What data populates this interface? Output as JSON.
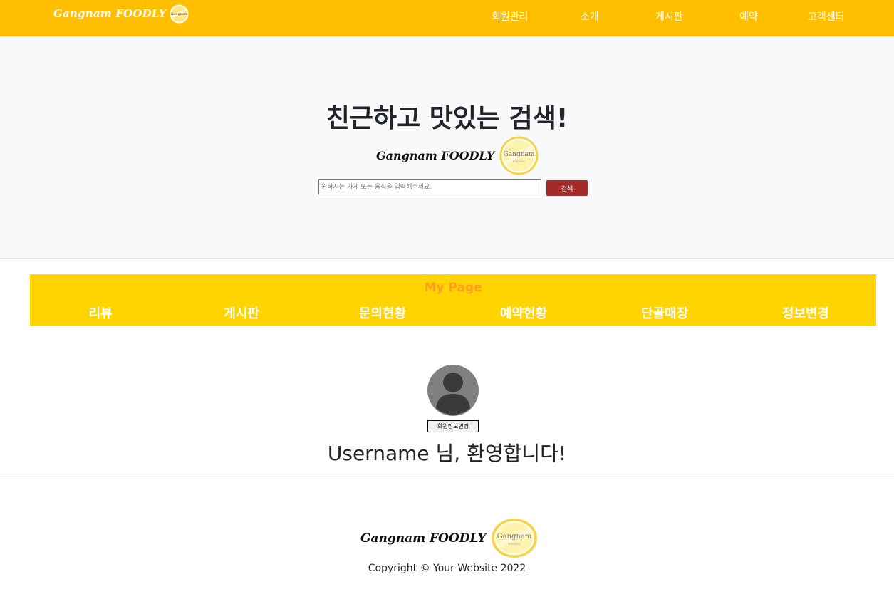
{
  "header": {
    "brand": "Gangnam FOODLY",
    "nav": [
      "회원관리",
      "소개",
      "게시판",
      "예약",
      "고객센터"
    ]
  },
  "hero": {
    "title": "친근하고 맛있는 검색!",
    "logo_text": "Gangnam FOODLY",
    "badge_text": "Gangnam",
    "badge_subtext": "FOODLY",
    "search_placeholder": "원하시는 가게 또는 음식을 입력해주세요.",
    "search_button": "검색"
  },
  "mypage": {
    "title": "My Page",
    "tabs": [
      "리뷰",
      "게시판",
      "문의현황",
      "예약현황",
      "단골매장",
      "정보변경"
    ]
  },
  "profile": {
    "edit_button": "회원정보변경",
    "welcome": "Username 님, 환영합니다!"
  },
  "footer": {
    "logo_text": "Gangnam FOODLY",
    "badge_text": "Gangnam",
    "badge_subtext": "FOODLY",
    "copyright": "Copyright © Your Website 2022"
  },
  "colors": {
    "navbar": "#ffbf00",
    "mypage_bar": "#ffd400",
    "mypage_title": "#ff9f1a",
    "search_button": "#a52a2a",
    "badge": "#f5d547"
  }
}
